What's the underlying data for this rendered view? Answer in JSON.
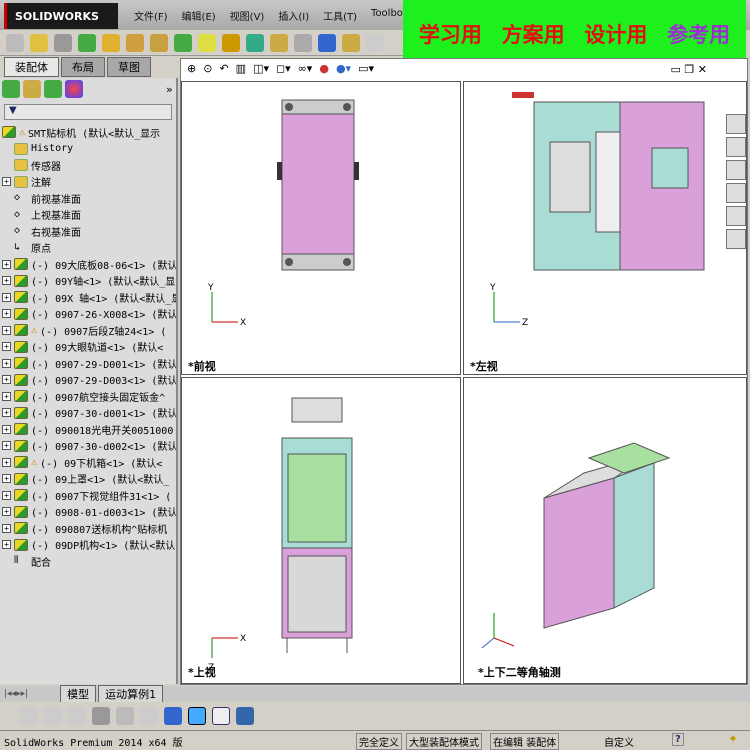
{
  "app": {
    "logo": "SOLIDWORKS",
    "menu": [
      "文件(F)",
      "编辑(E)",
      "视图(V)",
      "插入(I)",
      "工具(T)",
      "Toolbox"
    ]
  },
  "banner": {
    "items": [
      "学习用",
      "方案用",
      "设计用"
    ],
    "last": "参考用"
  },
  "left_tabs": [
    "装配体",
    "布局",
    "草图"
  ],
  "tree": {
    "root": "SMT贴标机  (默认<默认_显示",
    "items": [
      {
        "label": "History",
        "type": "history"
      },
      {
        "label": "传感器",
        "type": "folder"
      },
      {
        "label": "注解",
        "type": "annot",
        "expand": true
      },
      {
        "label": "前视基准面",
        "type": "plane"
      },
      {
        "label": "上视基准面",
        "type": "plane"
      },
      {
        "label": "右视基准面",
        "type": "plane"
      },
      {
        "label": "原点",
        "type": "origin"
      },
      {
        "label": "(-) 09大底板08-06<1> (默认",
        "type": "asm"
      },
      {
        "label": "(-) 09Y轴<1> (默认<默认_显",
        "type": "asm"
      },
      {
        "label": "(-) 09X 轴<1> (默认<默认_显",
        "type": "asm"
      },
      {
        "label": "(-) 0907-26-X008<1> (默认",
        "type": "asm"
      },
      {
        "label": "(-) 0907后段Z轴24<1> (",
        "type": "asm",
        "warn": true
      },
      {
        "label": "(-) 09大眼轨道<1> (默认<",
        "type": "asm"
      },
      {
        "label": "(-) 0907-29-D001<1> (默认",
        "type": "asm"
      },
      {
        "label": "(-) 0907-29-D003<1> (默认",
        "type": "asm"
      },
      {
        "label": "(-) 0907航空接头固定钣金^",
        "type": "asm"
      },
      {
        "label": "(-) 0907-30-d001<1> (默认",
        "type": "asm"
      },
      {
        "label": "(-) 090018光电开关0051000",
        "type": "asm"
      },
      {
        "label": "(-) 0907-30-d002<1> (默认",
        "type": "asm"
      },
      {
        "label": "(-) 09下机箱<1> (默认<",
        "type": "asm",
        "warn": true
      },
      {
        "label": "(-) 09上罩<1> (默认<默认_",
        "type": "asm"
      },
      {
        "label": "(-) 0907下视觉组件31<1> (",
        "type": "asm"
      },
      {
        "label": "(-) 0908-01-d003<1> (默认",
        "type": "asm"
      },
      {
        "label": "(-) 090807送标机构^贴标机",
        "type": "asm"
      },
      {
        "label": "(-) 09DP机构<1> (默认<默认",
        "type": "asm"
      },
      {
        "label": "配合",
        "type": "mate"
      }
    ]
  },
  "views": {
    "front": "*前视",
    "left": "*左视",
    "top": "*上视",
    "iso": "*上下二等角轴测"
  },
  "bottom_tabs": [
    "模型",
    "运动算例1"
  ],
  "status": {
    "product": "SolidWorks Premium 2014 x64 版",
    "defined": "完全定义",
    "mode": "大型装配体模式",
    "editing": "在编辑 装配体",
    "custom": "自定义",
    "help": "?"
  },
  "colors": {
    "pink": "#d9a0d9",
    "teal": "#a8dcd4",
    "green": "#a8e0a0",
    "gray": "#d8d8d8"
  }
}
